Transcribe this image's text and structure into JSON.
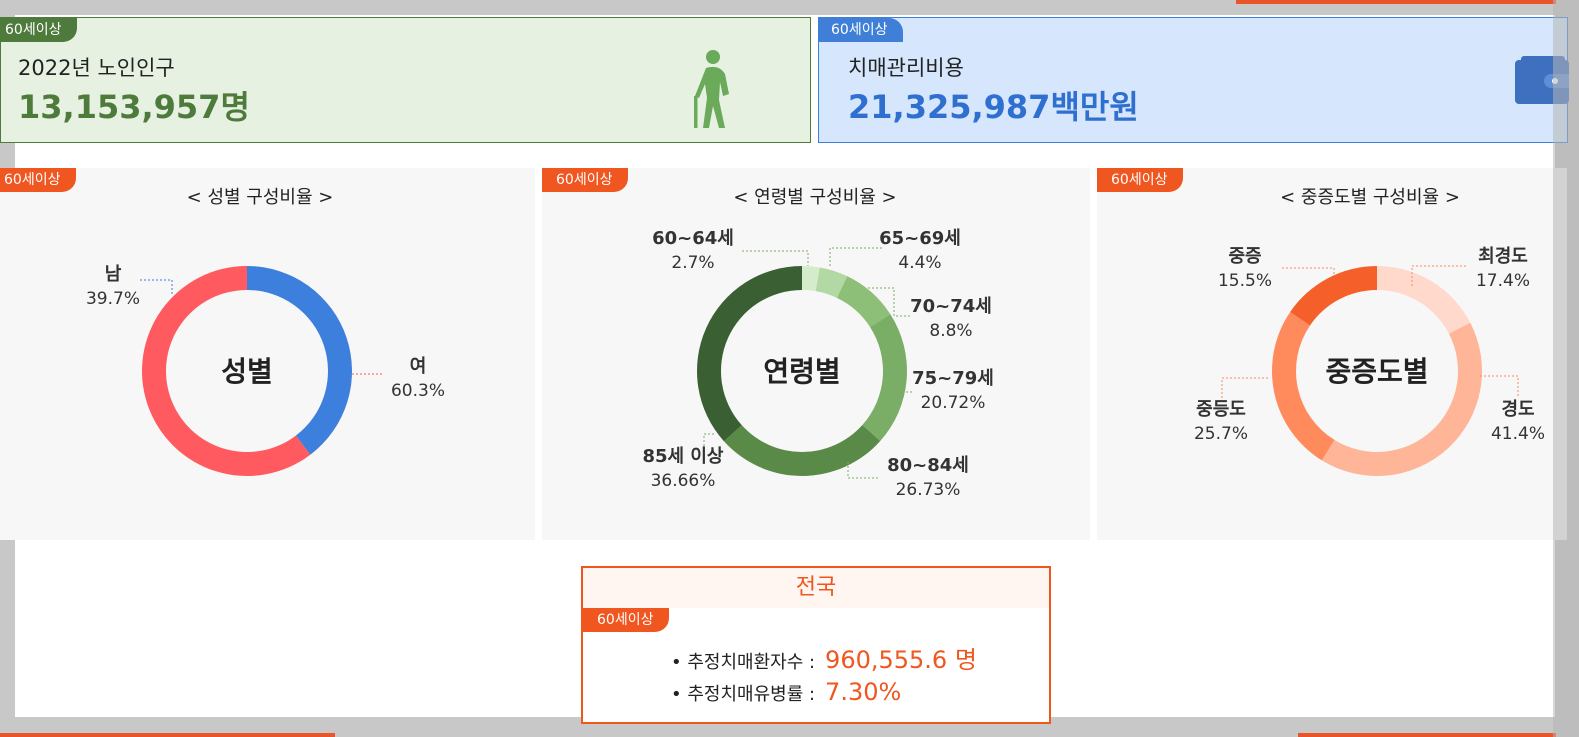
{
  "colors": {
    "green": "#4e7a3c",
    "blue": "#3f7fd8",
    "orange": "#f0561f",
    "female_red": "#ff5a5f"
  },
  "age_tag": "60세이상",
  "population_card": {
    "label": "2022년 노인인구",
    "value": "13,153,957명",
    "icon": "elderly-person-icon"
  },
  "cost_card": {
    "label": "치매관리비용",
    "value": "21,325,987백만원",
    "icon": "wallet-icon"
  },
  "gender_panel": {
    "title": "< 성별 구성비율 >",
    "center_label": "성별"
  },
  "age_panel": {
    "title": "< 연령별 구성비율 >",
    "center_label": "연령별"
  },
  "severity_panel": {
    "title": "< 중증도별 구성비율 >",
    "center_label": "중증도별"
  },
  "chart_data": [
    {
      "type": "pie",
      "title": "< 성별 구성비율 >",
      "categories": [
        "남",
        "여"
      ],
      "values": [
        39.7,
        60.3
      ],
      "value_labels": [
        "39.7%",
        "60.3%"
      ],
      "colors": [
        "#3d7fdc",
        "#ff5a5f"
      ]
    },
    {
      "type": "pie",
      "title": "< 연령별 구성비율 >",
      "categories": [
        "60~64세",
        "65~69세",
        "70~74세",
        "75~79세",
        "80~84세",
        "85세 이상"
      ],
      "values": [
        2.7,
        4.4,
        8.8,
        20.72,
        26.73,
        36.66
      ],
      "value_labels": [
        "2.7%",
        "4.4%",
        "8.8%",
        "20.72%",
        "26.73%",
        "36.66%"
      ],
      "colors": [
        "#d4eccb",
        "#b2d9a3",
        "#8dbf78",
        "#7aae66",
        "#5a8a48",
        "#3a5f33"
      ]
    },
    {
      "type": "pie",
      "title": "< 중증도별 구성비율 >",
      "categories": [
        "최경도",
        "경도",
        "중등도",
        "중증"
      ],
      "values": [
        17.4,
        41.4,
        25.7,
        15.5
      ],
      "value_labels": [
        "17.4%",
        "41.4%",
        "25.7%",
        "15.5%"
      ],
      "colors": [
        "#ffd9cb",
        "#ffb597",
        "#ff8a5c",
        "#f5602a"
      ]
    }
  ],
  "national": {
    "title": "전국",
    "rows": [
      {
        "label": "• 추정치매환자수 :",
        "value": "960,555.6 명"
      },
      {
        "label": "• 추정치매유병률 :",
        "value": "7.30%"
      }
    ]
  }
}
